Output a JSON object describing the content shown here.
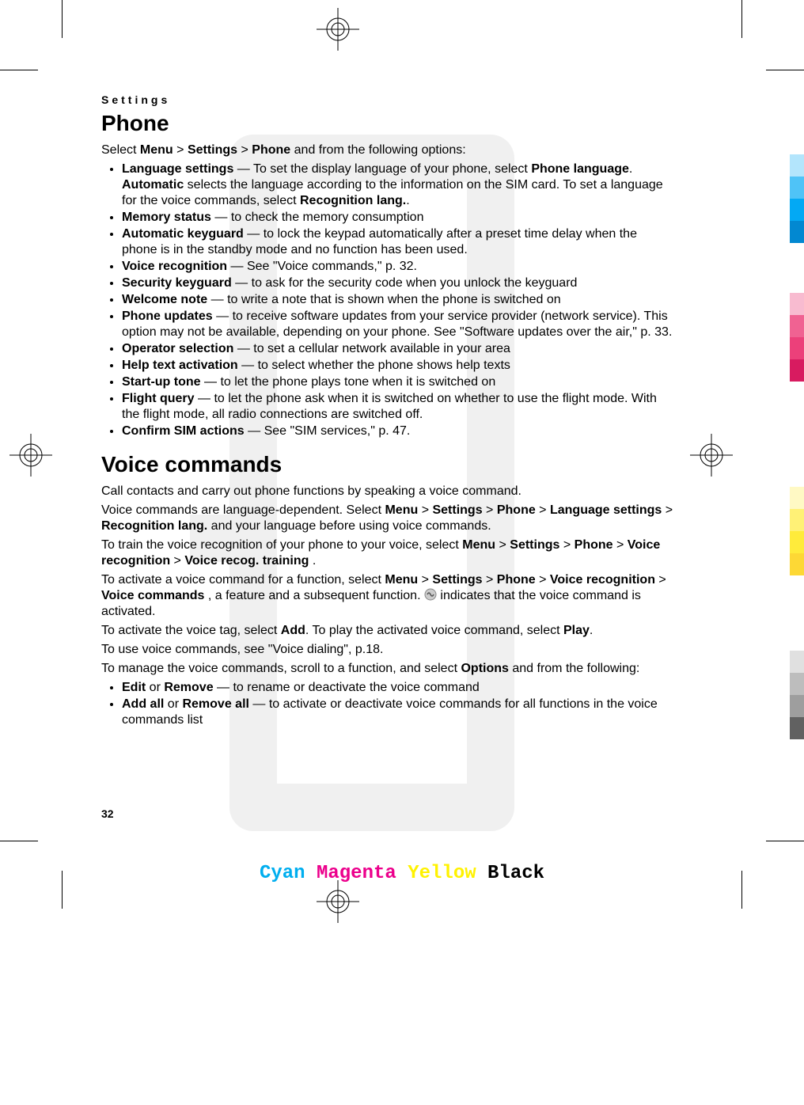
{
  "header": {
    "running": "Settings"
  },
  "phone": {
    "title": "Phone",
    "intro": {
      "pre": "Select ",
      "path": [
        "Menu",
        "Settings",
        "Phone"
      ],
      "post": " and from the following options:"
    },
    "items": [
      {
        "term": "Language settings",
        "rest": " — To set the display language of your phone, select ",
        "bold2": "Phone language",
        "rest2": ". ",
        "bold3": "Automatic",
        "rest3": " selects the language according to the information on the SIM card. To set a language for the voice commands, select ",
        "bold4": "Recognition lang.",
        "rest4": "."
      },
      {
        "term": "Memory status",
        "rest": " — to check the memory consumption"
      },
      {
        "term": "Automatic keyguard",
        "rest": " — to lock the keypad automatically after a preset time delay when the phone is in the standby mode and no function has been used."
      },
      {
        "term": "Voice recognition",
        "rest": " — See \"Voice commands,\" p. 32."
      },
      {
        "term": "Security keyguard",
        "rest": " — to ask for the security code when you unlock the keyguard"
      },
      {
        "term": "Welcome note",
        "rest": " — to write a note that is shown when the phone is switched on"
      },
      {
        "term": "Phone updates",
        "rest": " — to receive software updates from your service provider (network service). This option may not be available, depending on your phone. See \"Software updates over the air,\" p. 33."
      },
      {
        "term": "Operator selection",
        "rest": " —  to set a cellular network available in your area"
      },
      {
        "term": "Help text activation",
        "rest": " — to select whether the phone shows help texts"
      },
      {
        "term": "Start-up tone",
        "rest": " — to let the phone plays tone when it is switched on"
      },
      {
        "term": "Flight query",
        "rest": " — to let the phone ask when it is switched on whether to use the flight mode. With the flight mode, all radio connections are switched off."
      },
      {
        "term": "Confirm SIM actions",
        "rest": " —  See \"SIM services,\" p. 47."
      }
    ]
  },
  "voice": {
    "title": "Voice commands",
    "p1": "Call contacts and carry out phone functions by speaking a voice command.",
    "p2a": "Voice commands are language-dependent. Select ",
    "p2path": [
      "Menu",
      "Settings",
      "Phone",
      "Language settings",
      "Recognition lang."
    ],
    "p2b": " and your language before using voice commands.",
    "p3a": "To train the voice recognition of your phone to your voice, select ",
    "p3path": [
      "Menu",
      "Settings",
      "Phone",
      "Voice recognition",
      "Voice recog. training"
    ],
    "p3b": ".",
    "p4a": "To activate a voice command for a function, select ",
    "p4path": [
      "Menu",
      "Settings",
      "Phone",
      "Voice recognition",
      "Voice commands"
    ],
    "p4b": ", a feature and a subsequent function. ",
    "p4c": " indicates that the voice command is activated.",
    "p5a": "To activate the voice tag, select ",
    "p5b": "Add",
    "p5c": ". To play the activated voice command, select ",
    "p5d": "Play",
    "p5e": ".",
    "p6": "To use voice commands, see \"Voice dialing\", p.18.",
    "p7a": "To manage the voice commands, scroll to a function, and select ",
    "p7b": "Options",
    "p7c": " and from the following:",
    "items": [
      {
        "t1": "Edit",
        "or": " or ",
        "t2": "Remove",
        "rest": " — to rename or deactivate the voice command"
      },
      {
        "t1": "Add all",
        "or": " or ",
        "t2": "Remove all",
        "rest": " — to activate or deactivate voice commands for all functions in the voice commands list"
      }
    ]
  },
  "page_number": "32",
  "footer": {
    "c": "Cyan",
    "m": "Magenta",
    "y": "Yellow",
    "k": "Black"
  },
  "gt": " > "
}
